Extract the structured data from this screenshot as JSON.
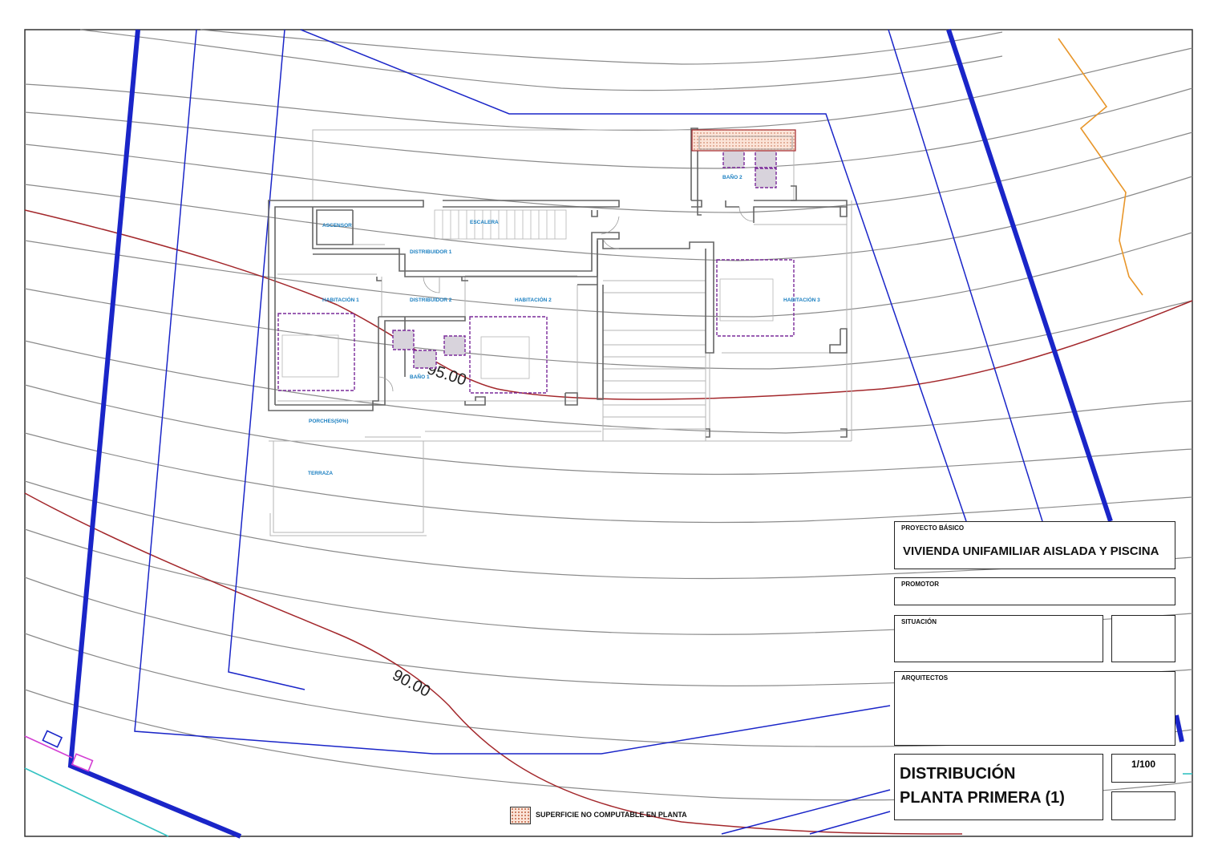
{
  "rooms": {
    "ascensor": "ASCENSOR",
    "escalera": "ESCALERA",
    "distribuidor1": "DISTRIBUIDOR 1",
    "distribuidor2": "DISTRIBUIDOR 2",
    "habitacion1": "HABITACIÓN 1",
    "habitacion2": "HABITACIÓN 2",
    "habitacion3": "HABITACIÓN 3",
    "bano1": "BAÑO 1",
    "bano2": "BAÑO 2",
    "porches": "PORCHES(50%)",
    "terraza": "TERRAZA"
  },
  "contours": {
    "label_95": "95.00",
    "label_90": "90.00"
  },
  "legend": {
    "text": "SUPERFICIE NO COMPUTABLE EN PLANTA"
  },
  "title_block": {
    "project_label": "PROYECTO BÁSICO",
    "project_name": "VIVIENDA UNIFAMILIAR AISLADA Y PISCINA",
    "promoter_label": "PROMOTOR",
    "situation_label": "SITUACIÓN",
    "architects_label": "ARQUITECTOS",
    "drawing_title_line1": "DISTRIBUCIÓN",
    "drawing_title_line2": "PLANTA PRIMERA (1)",
    "scale": "1/100"
  },
  "colors": {
    "contour": "#8a8a8a",
    "master_contour": "#a3272b",
    "boundary": "#1a25c8",
    "wall": "#666666",
    "room_text": "#1a7fc1",
    "furniture": "#7a2a9a",
    "orange_line": "#e8962a",
    "cyan_line": "#34c2c2"
  }
}
